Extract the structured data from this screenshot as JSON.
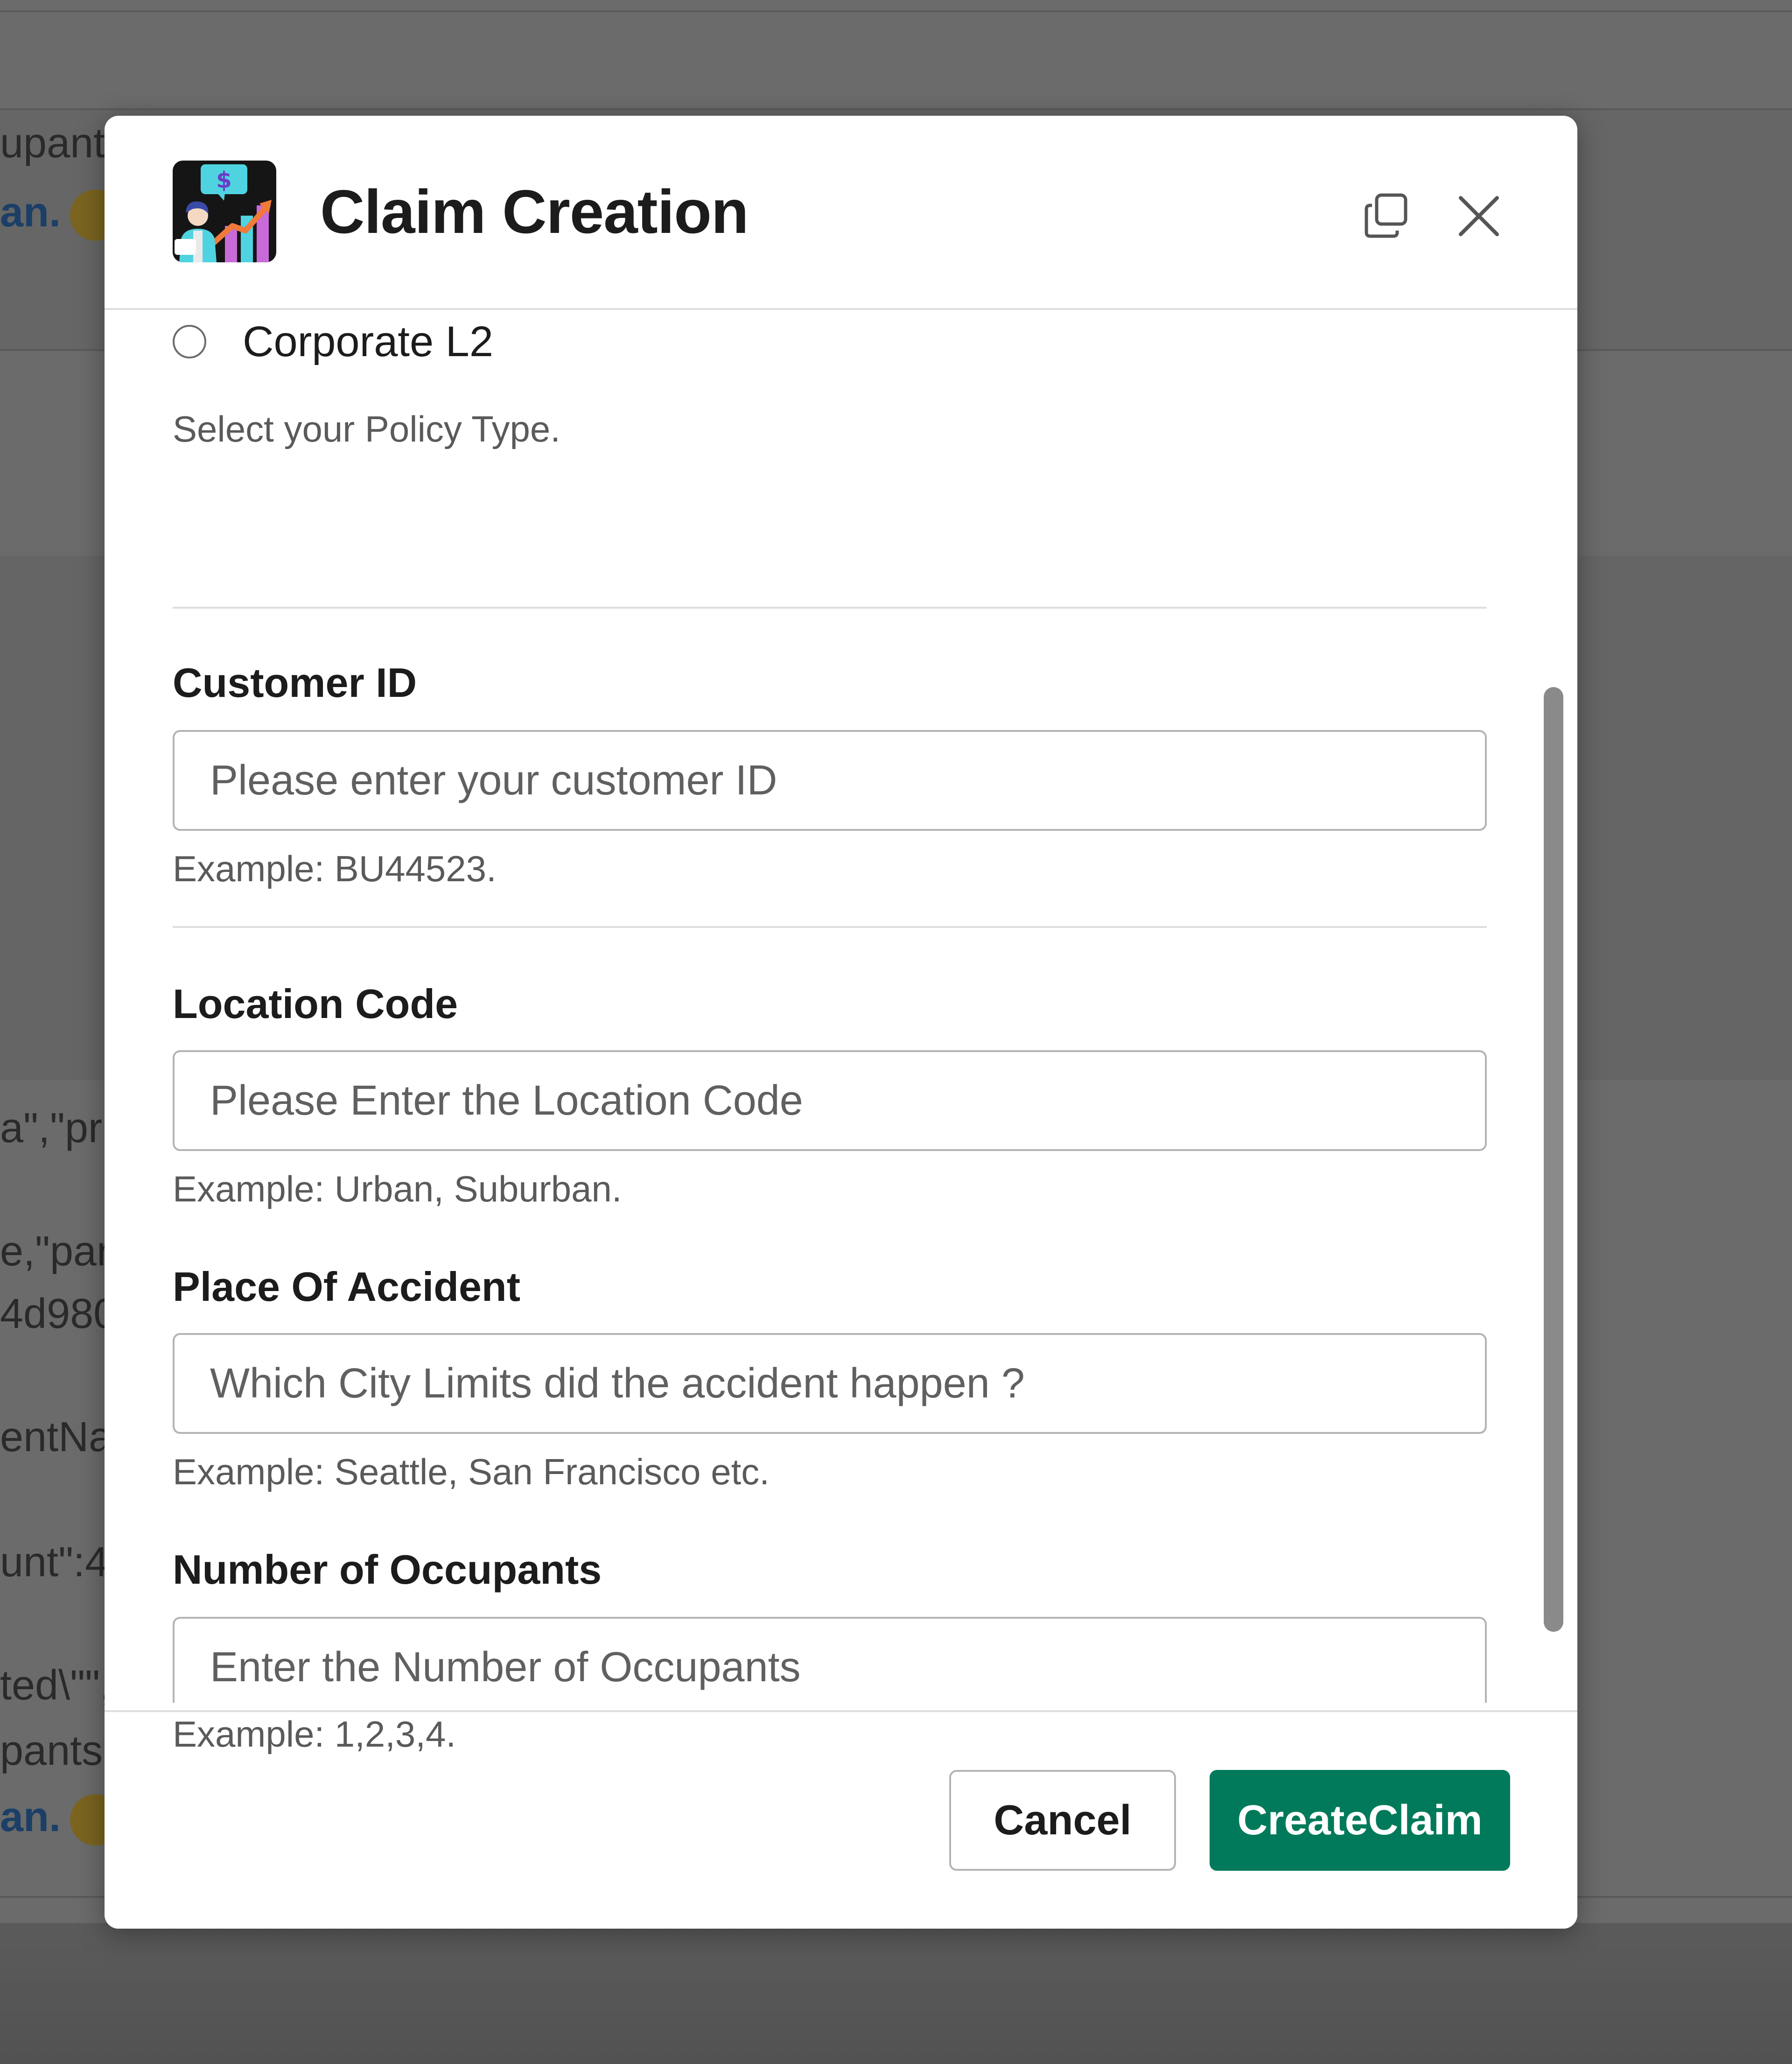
{
  "background": {
    "snippets": [
      "upant",
      "an.",
      "a\",\"pri",
      "e,\"pare",
      "4d980",
      "entNar",
      "unt\":4",
      "ted\\\"\",",
      "pants",
      "an."
    ]
  },
  "modal": {
    "title": "Claim Creation",
    "icons": {
      "logo": "claim-app-logo",
      "copy": "copy-window-icon",
      "close": "close-icon"
    },
    "policy_type": {
      "option_label": "Corporate L2",
      "hint": "Select your Policy Type."
    },
    "fields": {
      "customer_id": {
        "label": "Customer ID",
        "placeholder": "Please enter your customer ID",
        "value": "",
        "hint": "Example: BU44523."
      },
      "location_code": {
        "label": "Location Code",
        "placeholder": "Please Enter the Location Code",
        "value": "",
        "hint": "Example: Urban, Suburban."
      },
      "place_of_accident": {
        "label": "Place Of Accident",
        "placeholder": "Which City Limits did the accident happen ?",
        "value": "",
        "hint": "Example: Seattle, San Francisco etc."
      },
      "occupants": {
        "label": "Number of Occupants",
        "placeholder": "Enter the Number of Occupants",
        "value": "",
        "hint": "Example: 1,2,3,4."
      }
    },
    "footer": {
      "cancel_label": "Cancel",
      "create_label": "CreateClaim"
    },
    "colors": {
      "primary_button": "#007a5a",
      "backdrop": "#6b6b6b"
    }
  }
}
